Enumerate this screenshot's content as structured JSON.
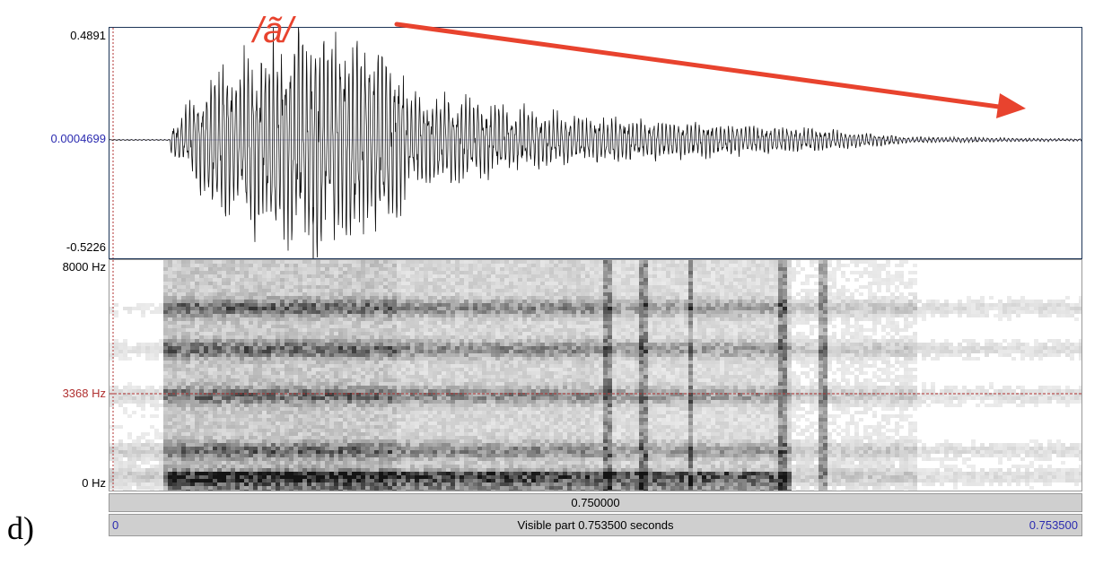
{
  "panel_label": "d)",
  "phoneme_label": "/ã/",
  "waveform": {
    "max_label": "0.4891",
    "mid_label": "0.0004699",
    "min_label": "-0.5226"
  },
  "spectrogram": {
    "top_label": "8000 Hz",
    "cursor_label": "3368 Hz",
    "bottom_label": "0 Hz"
  },
  "time_bar": {
    "cursor_time": "0.750000"
  },
  "visible_bar": {
    "start": "0",
    "text": "Visible part 0.753500 seconds",
    "end": "0.753500"
  },
  "colors": {
    "arrow": "#e8432e",
    "mid_line": "#2b2bb0",
    "cursor_line": "#b03030"
  }
}
